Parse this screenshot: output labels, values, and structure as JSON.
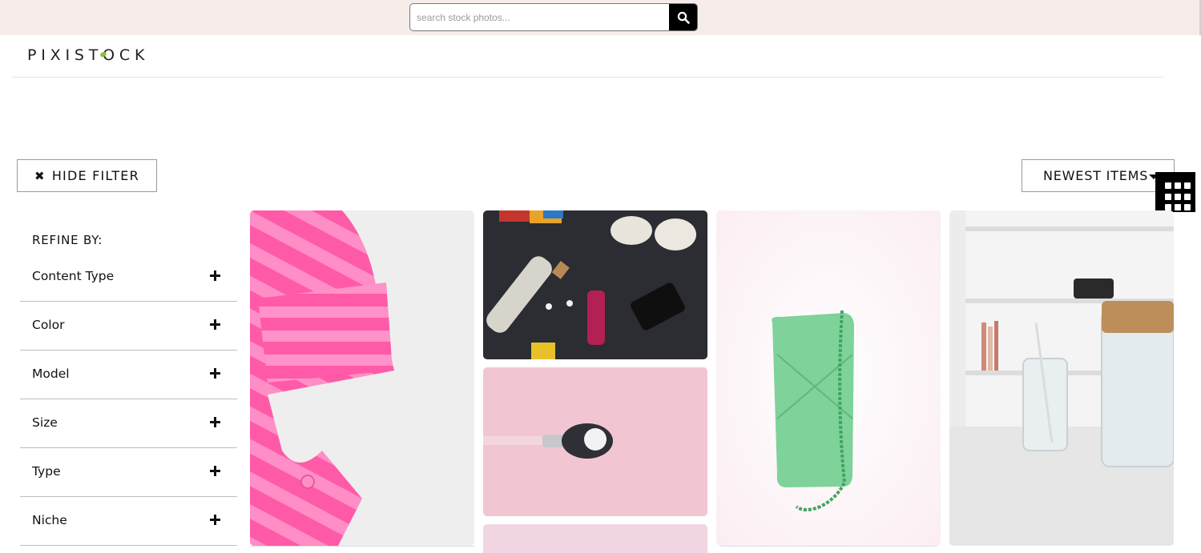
{
  "search": {
    "placeholder": "search stock photos..."
  },
  "brand": {
    "logo_text": "PIXISTOCK",
    "accent_color": "#8bbf3a"
  },
  "toolbar": {
    "hide_filter_label": "HIDE FILTER",
    "sort_label": "NEWEST ITEMS"
  },
  "filters": {
    "heading": "REFINE BY:",
    "items": [
      {
        "label": "Content Type"
      },
      {
        "label": "Color"
      },
      {
        "label": "Model"
      },
      {
        "label": "Size"
      },
      {
        "label": "Type"
      },
      {
        "label": "Niche"
      }
    ]
  },
  "photos": [
    {
      "subject": "pink striped shirt sleeve"
    },
    {
      "subject": "water bottle, sneakers, earbuds, dumbbell, phone"
    },
    {
      "subject": "makeup brush on pink background"
    },
    {
      "subject": "green quilted bag with chain"
    },
    {
      "subject": "glass jars with straw on table"
    },
    {
      "subject": "pink photo partially visible"
    }
  ],
  "icons": {
    "search": "search-icon",
    "close": "close-icon",
    "caret": "caret-down-icon",
    "grid": "grid-view-icon",
    "expand": "plus-icon"
  }
}
